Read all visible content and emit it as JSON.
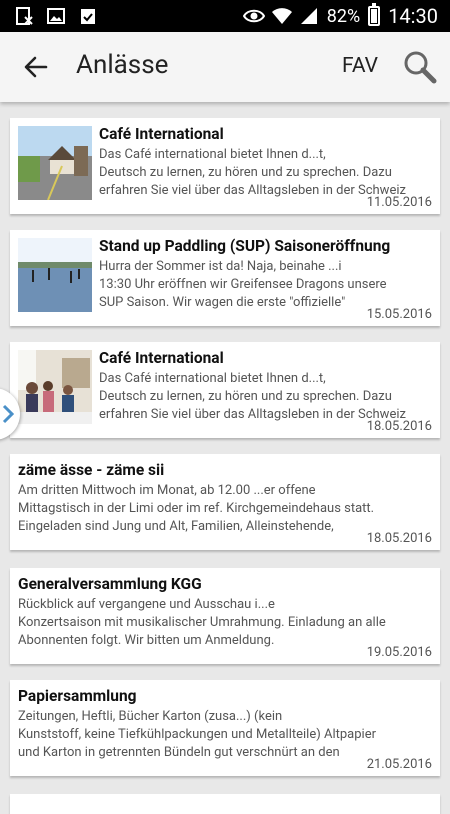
{
  "status": {
    "battery": "82%",
    "time": "14:30",
    "icons": [
      "wifi-icon",
      "signal-icon",
      "eye-icon",
      "battery-icon"
    ]
  },
  "appbar": {
    "title": "Anlässe",
    "fav_label": "FAV"
  },
  "events": [
    {
      "title": "Café International",
      "desc": "Das  Café international  bietet Ihnen d...t,\nDeutsch zu lernen, zu hören und zu sprechen. Dazu\nerfahren Sie viel über das Alltagsleben in der Schweiz",
      "date": "11.05.2016"
    },
    {
      "title": "Stand up Paddling (SUP) Saisoneröffnung",
      "desc": "Hurra der Sommer ist da! Naja, beinahe ...i\n13:30 Uhr eröffnen wir Greifensee Dragons unsere\nSUP Saison. Wir wagen die erste \"offizielle\"",
      "date": "15.05.2016"
    },
    {
      "title": "Café International",
      "desc": "Das  Café international  bietet Ihnen d...t,\nDeutsch zu lernen, zu hören und zu sprechen. Dazu\nerfahren Sie viel über das Alltagsleben in der Schweiz",
      "date": "18.05.2016"
    },
    {
      "title": "zäme ässe - zäme sii",
      "desc": "Am dritten Mittwoch im Monat, ab 12.00 ...er offene\nMittagstisch in der Limi oder im ref. Kirchgemeindehaus statt.\nEingeladen sind Jung und Alt, Familien, Alleinstehende,",
      "date": "18.05.2016"
    },
    {
      "title": "Generalversammlung KGG",
      "desc": "Rückblick auf vergangene und Ausschau i...e\nKonzertsaison mit musikalischer Umrahmung. Einladung an alle\nAbonnenten folgt. Wir bitten um Anmeldung.",
      "date": "19.05.2016"
    },
    {
      "title": "Papiersammlung",
      "desc": "Zeitungen, Heftli, Bücher  Karton (zusa...)  (kein\nKunststoff, keine Tiefkühlpackungen und Metallteile)   Altpapier\nund Karton in getrennten Bündeln gut verschnürt an den",
      "date": "21.05.2016"
    }
  ]
}
